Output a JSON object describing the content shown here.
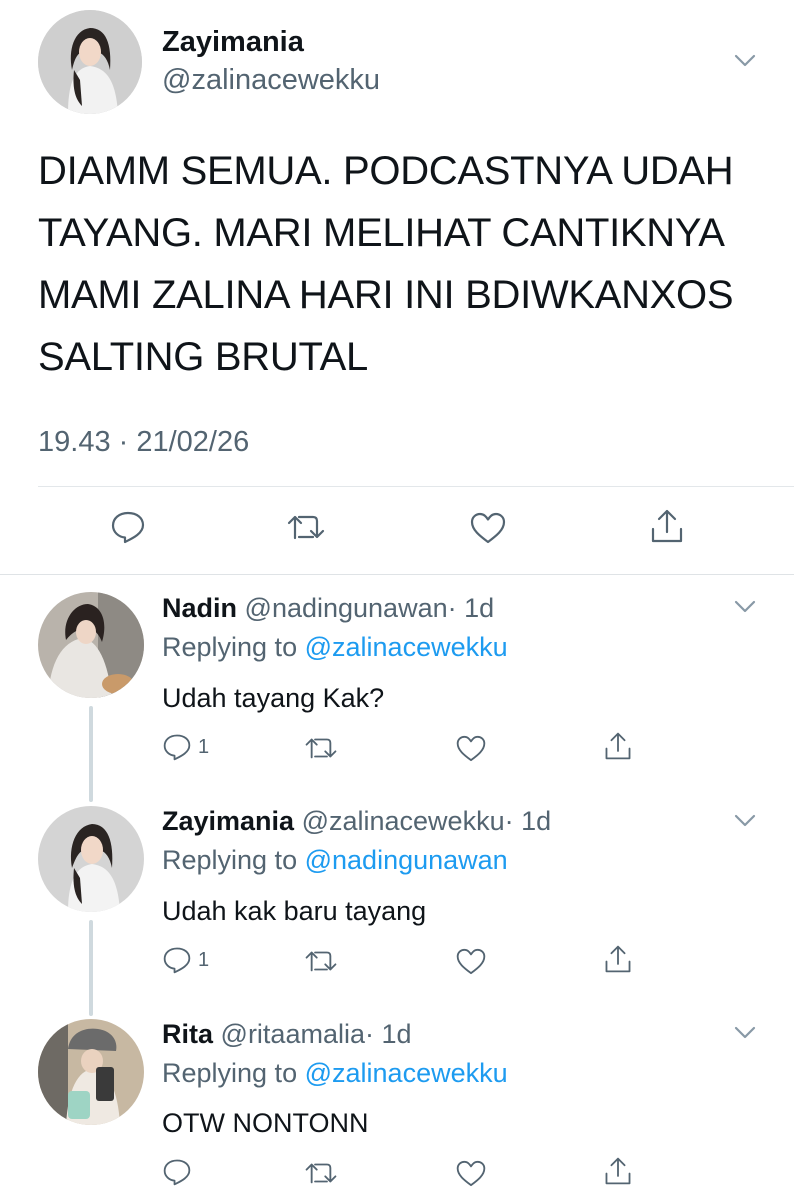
{
  "main_tweet": {
    "display_name": "Zayimania",
    "handle": "@zalinacewekku",
    "text_lines": [
      "DIAMM SEMUA. PODCASTNYA UDAH",
      "TAYANG. MARI MELIHAT CANTIKNYA",
      "MAMI ZALINA HARI INI BDIWKANXOS",
      "SALTING BRUTAL"
    ],
    "timestamp": "19.43 · 21/02/26"
  },
  "replies": [
    {
      "display_name": "Nadin",
      "handle": "@nadingunawan",
      "age": "· 1d",
      "replying_prefix": "Replying to",
      "replying_to": "@zalinacewekku",
      "text": "Udah tayang Kak?",
      "reply_count": "1"
    },
    {
      "display_name": "Zayimania",
      "handle": "@zalinacewekku",
      "age": "· 1d",
      "replying_prefix": "Replying to",
      "replying_to": "@nadingunawan",
      "text": "Udah kak baru tayang",
      "reply_count": "1"
    },
    {
      "display_name": "Rita",
      "handle": "@ritaamalia",
      "age": "· 1d",
      "replying_prefix": "Replying to",
      "replying_to": "@zalinacewekku",
      "text": "OTW NONTONN",
      "reply_count": ""
    }
  ],
  "icons": {
    "reply": "comment-bubble-icon",
    "retweet": "retweet-icon",
    "like": "heart-icon",
    "share": "share-icon",
    "more": "chevron-down-icon"
  },
  "colors": {
    "accent": "#1d9bf0",
    "secondary_text": "#536471",
    "thread_line": "#cfd9de"
  }
}
